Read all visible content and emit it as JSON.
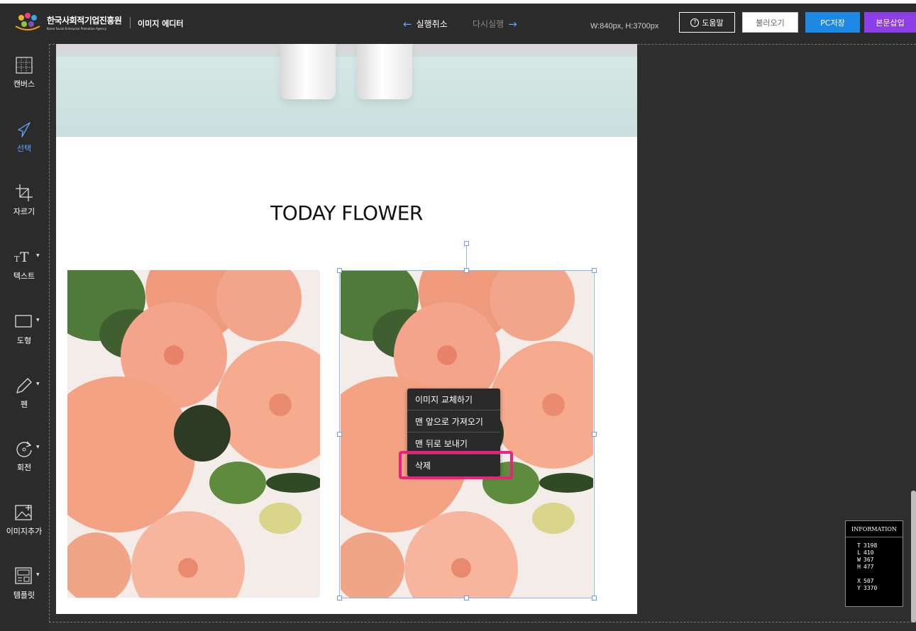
{
  "header": {
    "org_name_kr": "한국사회적기업진흥원",
    "org_name_en": "Korea Social Enterprise Promotion Agency",
    "app_title": "이미지 에디터",
    "undo_label": "실행취소",
    "redo_label": "다시실행",
    "canvas_size": "W:840px, H:3700px",
    "help_label": "도움말",
    "load_label": "불러오기",
    "save_pc_label": "PC저장",
    "insert_label": "본문삽입",
    "colors": {
      "save": "#1e88e5",
      "insert": "#8e3ee6",
      "accent": "#59a7ff"
    }
  },
  "sidebar": {
    "items": [
      {
        "label": "캔버스",
        "icon": "canvas-grid-icon",
        "active": false
      },
      {
        "label": "선택",
        "icon": "cursor-arrow-icon",
        "active": true
      },
      {
        "label": "자르기",
        "icon": "crop-icon",
        "active": false
      },
      {
        "label": "텍스트",
        "icon": "text-icon",
        "active": false
      },
      {
        "label": "도형",
        "icon": "rectangle-shape-icon",
        "active": false
      },
      {
        "label": "펜",
        "icon": "pen-icon",
        "active": false
      },
      {
        "label": "회전",
        "icon": "rotate-icon",
        "active": false
      },
      {
        "label": "이미지추가",
        "icon": "add-image-icon",
        "active": false
      },
      {
        "label": "템플릿",
        "icon": "template-icon",
        "active": false
      }
    ]
  },
  "canvas": {
    "heading": "TODAY FLOWER"
  },
  "context_menu": {
    "items": [
      "이미지 교체하기",
      "맨 앞으로 가져오기",
      "맨 뒤로 보내기",
      "삭제"
    ],
    "highlighted": "삭제",
    "highlight_color": "#e8237f"
  },
  "info_panel": {
    "title": "INFORMATION",
    "T": "3198",
    "L": "410",
    "W": "367",
    "H": "477",
    "X": "507",
    "Y": "3370"
  }
}
